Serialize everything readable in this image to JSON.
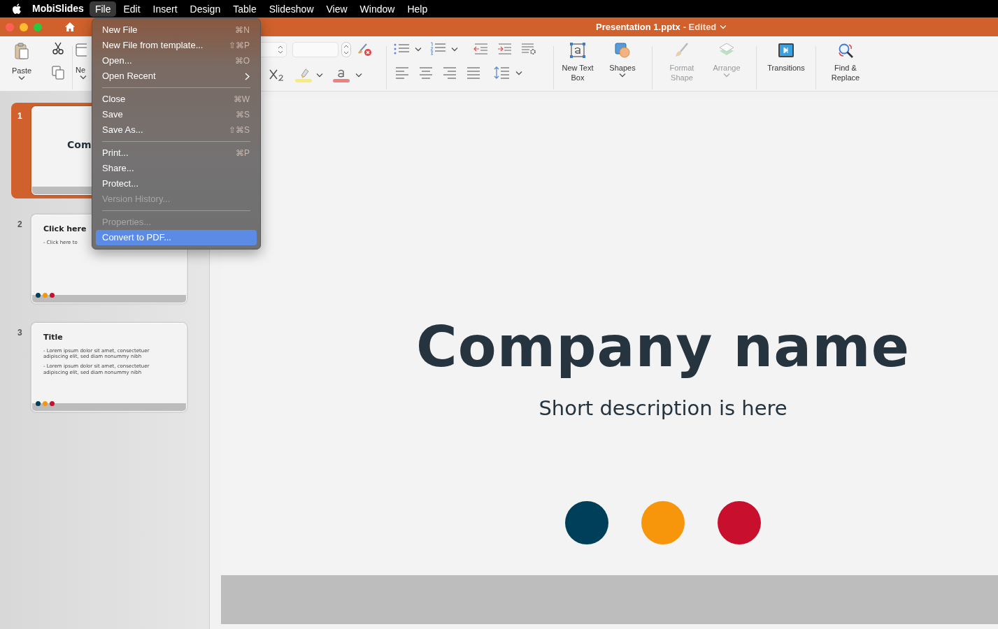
{
  "menu_bar": {
    "app_name": "MobiSlides",
    "menus": [
      {
        "label": "File",
        "selected": true
      },
      {
        "label": "Edit",
        "selected": false
      },
      {
        "label": "Insert",
        "selected": false
      },
      {
        "label": "Design",
        "selected": false
      },
      {
        "label": "Table",
        "selected": false
      },
      {
        "label": "Slideshow",
        "selected": false
      },
      {
        "label": "View",
        "selected": false
      },
      {
        "label": "Window",
        "selected": false
      },
      {
        "label": "Help",
        "selected": false
      }
    ]
  },
  "window": {
    "title": "Presentation 1.pptx",
    "status": "- Edited"
  },
  "ribbon": {
    "left_buttons": [
      {
        "label": "Paste",
        "dropdown": true
      },
      {
        "label": "Ne",
        "dropdown": true
      }
    ],
    "large_buttons": [
      {
        "label": "New Text Box",
        "dropdown": false,
        "disabled": false
      },
      {
        "label": "Shapes",
        "dropdown": true,
        "disabled": false
      },
      {
        "label": "Format Shape",
        "dropdown": false,
        "disabled": true
      },
      {
        "label": "Arrange",
        "dropdown": true,
        "disabled": true
      },
      {
        "label": "Transitions",
        "dropdown": false,
        "disabled": false
      },
      {
        "label": "Find & Replace",
        "dropdown": false,
        "disabled": false
      }
    ]
  },
  "slides": [
    {
      "number": "1",
      "selected": true,
      "kind": "title",
      "title": "Com"
    },
    {
      "number": "2",
      "selected": false,
      "kind": "content",
      "title": "Click here",
      "bullets": [
        "- Click here to"
      ],
      "dots": [
        {
          "color": "#003f5a"
        },
        {
          "color": "#f7960a"
        },
        {
          "color": "#c8102e"
        }
      ]
    },
    {
      "number": "3",
      "selected": false,
      "kind": "content",
      "title": "Title",
      "bullets": [
        "- Lorem ipsum dolor sit amet, consectetuer adipiscing elit, sed diam nonummy nibh",
        "- Lorem ipsum dolor sit amet, consectetuer adipiscing elit, sed diam nonummy nibh"
      ],
      "dots": [
        {
          "color": "#003f5a"
        },
        {
          "color": "#f7960a"
        },
        {
          "color": "#c8102e"
        }
      ]
    }
  ],
  "slide": {
    "title": "Company name",
    "subtitle": "Short description is here",
    "dots": [
      {
        "color": "#003f5a"
      },
      {
        "color": "#f7960a"
      },
      {
        "color": "#c8102e"
      }
    ]
  },
  "file_menu": {
    "items": [
      {
        "kind": "item",
        "label": "New File",
        "shortcut": "⌘N",
        "disabled": false,
        "selected": false
      },
      {
        "kind": "item",
        "label": "New File from template...",
        "shortcut": "⇧⌘P",
        "disabled": false,
        "selected": false
      },
      {
        "kind": "item",
        "label": "Open...",
        "shortcut": "⌘O",
        "disabled": false,
        "selected": false
      },
      {
        "kind": "item",
        "label": "Open Recent",
        "submenu": true,
        "disabled": false,
        "selected": false
      },
      {
        "kind": "separator"
      },
      {
        "kind": "item",
        "label": "Close",
        "shortcut": "⌘W",
        "disabled": false,
        "selected": false
      },
      {
        "kind": "item",
        "label": "Save",
        "shortcut": "⌘S",
        "disabled": false,
        "selected": false
      },
      {
        "kind": "item",
        "label": "Save As...",
        "shortcut": "⇧⌘S",
        "disabled": false,
        "selected": false
      },
      {
        "kind": "separator"
      },
      {
        "kind": "item",
        "label": "Print...",
        "shortcut": "⌘P",
        "disabled": false,
        "selected": false
      },
      {
        "kind": "item",
        "label": "Share...",
        "disabled": false,
        "selected": false
      },
      {
        "kind": "item",
        "label": "Protect...",
        "disabled": false,
        "selected": false
      },
      {
        "kind": "item",
        "label": "Version History...",
        "disabled": true,
        "selected": false
      },
      {
        "kind": "separator"
      },
      {
        "kind": "item",
        "label": "Properties...",
        "disabled": true,
        "selected": false
      },
      {
        "kind": "item",
        "label": "Convert to PDF...",
        "disabled": false,
        "selected": true
      }
    ]
  }
}
